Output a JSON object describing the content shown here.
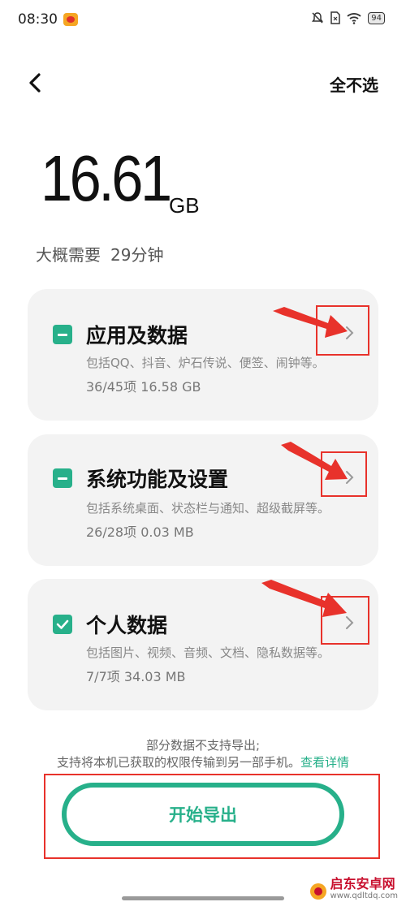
{
  "status_bar": {
    "time": "08:30",
    "battery": "94"
  },
  "header": {
    "deselect_all_label": "全不选"
  },
  "summary": {
    "size_value": "16.61",
    "size_unit": "GB",
    "estimate_label": "大概需要",
    "estimate_value": "29分钟"
  },
  "categories": [
    {
      "title": "应用及数据",
      "description": "包括QQ、抖音、炉石传说、便签、闹钟等。",
      "stats": "36/45项  16.58 GB",
      "state": "partial"
    },
    {
      "title": "系统功能及设置",
      "description": "包括系统桌面、状态栏与通知、超级截屏等。",
      "stats": "26/28项  0.03 MB",
      "state": "partial"
    },
    {
      "title": "个人数据",
      "description": "包括图片、视频、音频、文档、隐私数据等。",
      "stats": "7/7项  34.03 MB",
      "state": "checked"
    }
  ],
  "notice": {
    "line1": "部分数据不支持导出;",
    "line2": "支持将本机已获取的权限传输到另一部手机。",
    "link_label": "查看详情"
  },
  "export_button": {
    "label": "开始导出"
  },
  "watermark": {
    "title": "启东安卓网",
    "url": "www.qdltdq.com"
  },
  "colors": {
    "accent": "#27b08a",
    "annotation": "#e8322b",
    "card_bg": "#f3f3f3"
  }
}
